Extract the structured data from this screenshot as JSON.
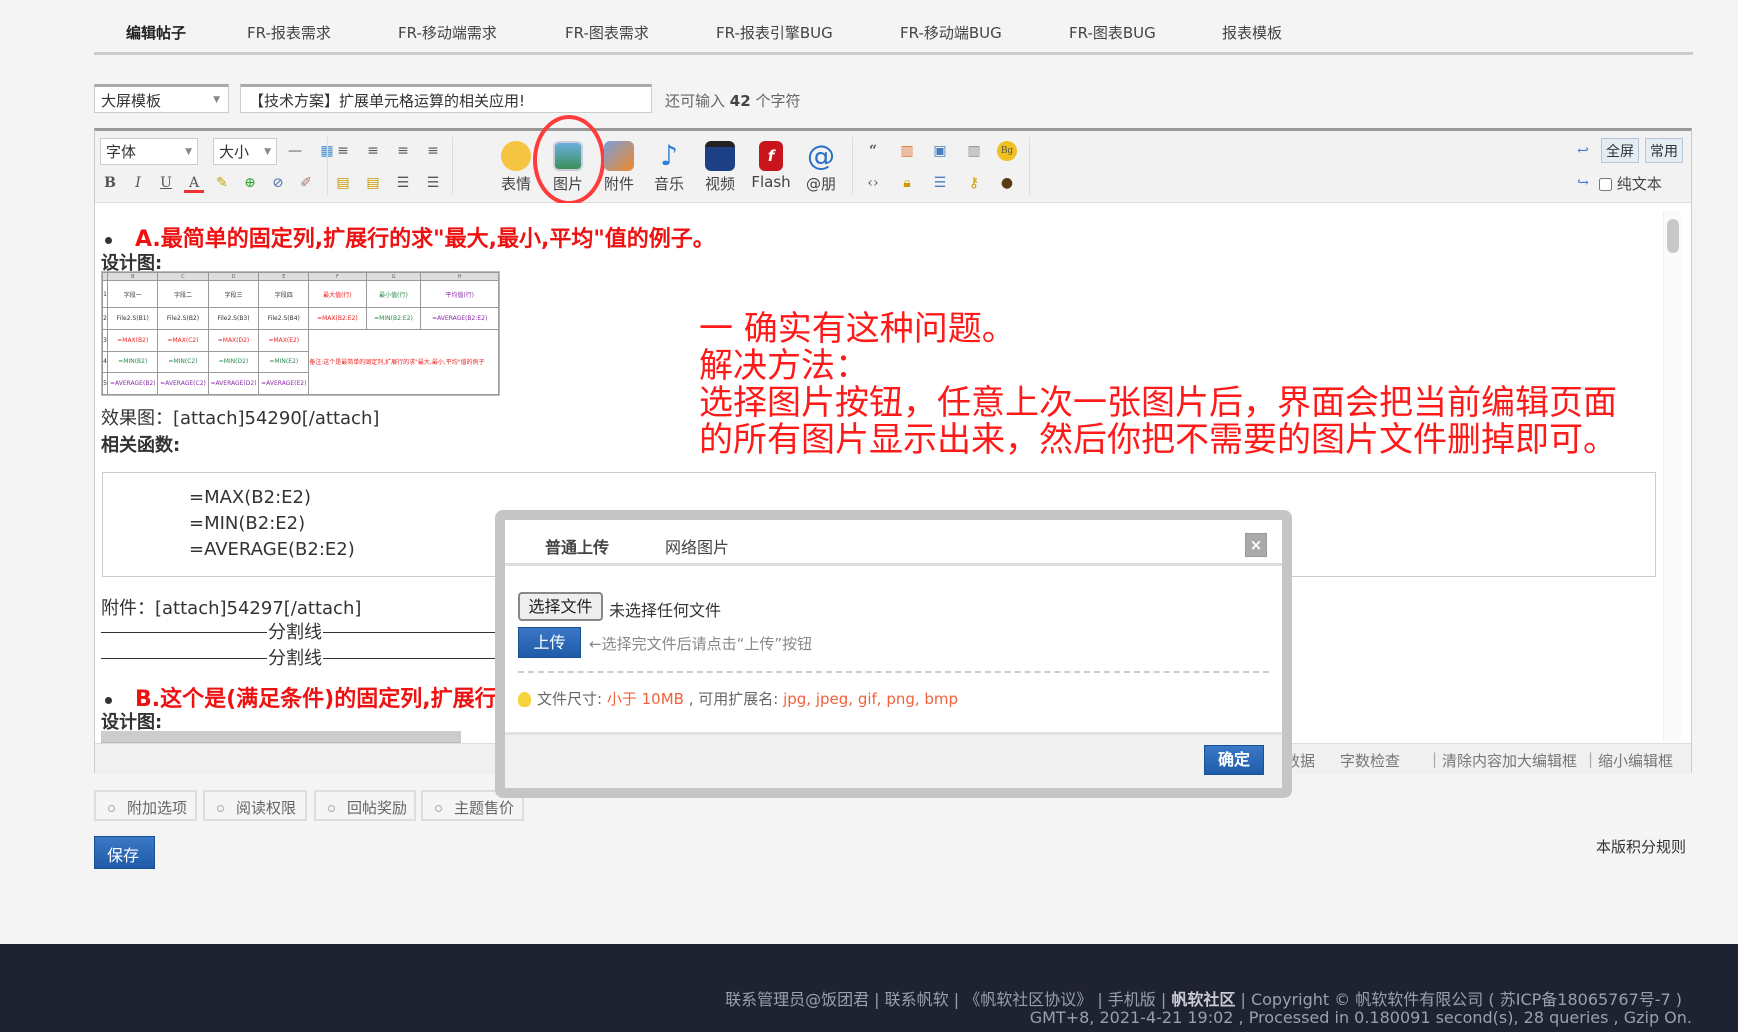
{
  "nav": {
    "tabs": [
      "编辑帖子",
      "FR-报表需求",
      "FR-移动端需求",
      "FR-图表需求",
      "FR-报表引擎BUG",
      "FR-移动端BUG",
      "FR-图表BUG",
      "报表模板"
    ]
  },
  "post": {
    "category": "大屏模板",
    "title": "【技术方案】扩展单元格运算的相关应用!",
    "counter_prefix": "还可输入",
    "counter_value": "42",
    "counter_suffix": "个字符"
  },
  "toolbar": {
    "font": "字体",
    "size": "大小",
    "big_buttons": [
      "表情",
      "图片",
      "附件",
      "音乐",
      "视频",
      "Flash",
      "@朋"
    ],
    "fullscreen": "全屏",
    "common": "常用",
    "plaintext": "纯文本",
    "highlight_color": "#ff3b3b"
  },
  "content": {
    "heading_a": "A.最简单的固定列,扩展行的求\"最大,最小,平均\"值的例子。",
    "design_label": "设计图:",
    "effect": "效果图：[attach]54290[/attach]",
    "functions_label": "相关函数:",
    "formulas": [
      "=MAX(B2:E2)",
      "=MIN(B2:E2)",
      "=AVERAGE(B2:E2)"
    ],
    "attachment": "附件：[attach]54297[/attach]",
    "divider": "分割线",
    "heading_b": "B.这个是(满足条件)的固定列,扩展行",
    "design_table": {
      "cols": [
        "",
        "B",
        "C",
        "D",
        "E",
        "F",
        "G",
        "H"
      ],
      "header": [
        "字段一",
        "字段二",
        "字段三",
        "字段四",
        "最大值(行)",
        "最小值(行)",
        "平均值(行)"
      ],
      "row2": [
        "File2.S(B1)",
        "File2.S(B2)",
        "File2.S(B3)",
        "File2.S(B4)",
        "=MAX(B2:E2)",
        "=MIN(B2:E2)",
        "=AVERAGE(B2:E2)"
      ],
      "row3": [
        "=MAX(B2)",
        "=MAX(C2)",
        "=MAX(D2)",
        "=MAX(E2)"
      ],
      "row4": [
        "=MIN(B2)",
        "=MIN(C2)",
        "=MIN(D2)",
        "=MIN(E2)"
      ],
      "row5": [
        "=AVERAGE(B2)",
        "=AVERAGE(C2)",
        "=AVERAGE(D2)",
        "=AVERAGE(E2)"
      ],
      "note": "备注:这个是最简单的固定列,扩展行的求\"最大,最小,平均\"值的例子"
    },
    "annotation": [
      "一 确实有这种问题。",
      "解决方法：",
      "选择图片按钮，任意上次一张图片后，界面会把当前编辑页面",
      "的所有图片显示出来，然后你把不需要的图片文件删掉即可。"
    ]
  },
  "statusbar": {
    "data": "数据",
    "wordcheck": "字数检查",
    "clear": "清除内容",
    "enlarge": "加大编辑框",
    "shrink": "缩小编辑框"
  },
  "dialog": {
    "tabs": [
      "普通上传",
      "网络图片"
    ],
    "close": "×",
    "choose_file": "选择文件",
    "no_file": "未选择任何文件",
    "upload": "上传",
    "upload_hint": "←选择完文件后请点击“上传”按钮",
    "size_label": "文件尺寸:",
    "size_value": "小于 10MB",
    "ext_label": ", 可用扩展名:",
    "ext_value": "jpg, jpeg, gif, png, bmp",
    "confirm": "确定"
  },
  "bottom_tabs": [
    "附加选项",
    "阅读权限",
    "回帖奖励",
    "主题售价"
  ],
  "save": "保存",
  "rules": "本版积分规则",
  "footer": {
    "contact_admin": "联系管理员@饭团君",
    "contact_company": "联系帆软",
    "agreement": "《帆软社区协议》",
    "mobile": "手机版",
    "community": "帆软社区",
    "copyright": "Copyright © 帆软软件有限公司",
    "icp": "苏ICP备18065767号-7",
    "stats": "GMT+8, 2021-4-21 19:02 , Processed in 0.180091 second(s), 28 queries , Gzip On."
  }
}
